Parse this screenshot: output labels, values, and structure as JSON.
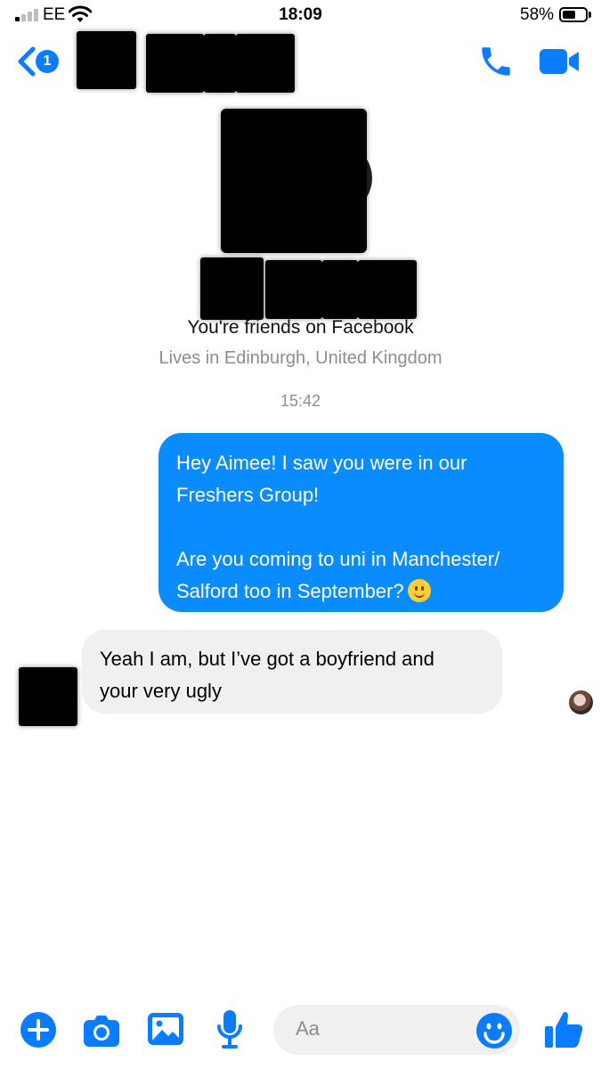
{
  "status_bar": {
    "carrier": "EE",
    "time": "18:09",
    "battery_percent": "58%",
    "battery_level": 0.58
  },
  "header": {
    "unread_count": "1",
    "icons": {
      "back": "chevron-left-icon",
      "call": "phone-icon",
      "video": "video-camera-icon"
    }
  },
  "profile": {
    "friends_text": "You're friends on Facebook",
    "lives_text": "Lives in Edinburgh, United Kingdom"
  },
  "conversation": {
    "timestamp": "15:42",
    "messages": [
      {
        "direction": "outgoing",
        "line1": "Hey Aimee! I saw you were in our",
        "line2": "Freshers Group!",
        "line3": "Are you coming to uni in Manchester/",
        "line4": "Salford too in September?",
        "emoji": "slightly-smiling-face"
      },
      {
        "direction": "incoming",
        "line1": "Yeah I am, but I’ve got a boyfriend and",
        "line2": "your very ugly"
      }
    ]
  },
  "composer": {
    "placeholder": "Aa",
    "icons": [
      "plus-icon",
      "camera-icon",
      "gallery-icon",
      "microphone-icon",
      "emoji-icon",
      "thumbs-up-icon"
    ]
  },
  "colors": {
    "accent": "#0a7cff",
    "outgoing_bubble": "#0a8cff",
    "incoming_bubble": "#f0f0f0",
    "muted_text": "#8a8d91"
  }
}
